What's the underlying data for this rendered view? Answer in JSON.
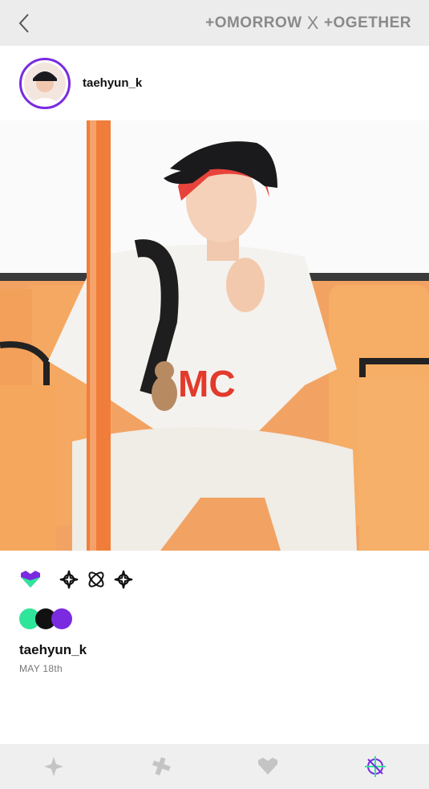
{
  "header": {
    "brand_left": "+OMORROW",
    "brand_sep": "X",
    "brand_right": "+OGETHER"
  },
  "post": {
    "username": "taehyun_k",
    "caption_username": "taehyun_k",
    "date": "MAY 18th"
  },
  "colors": {
    "accent_purple": "#7a2be0",
    "mint": "#2ee59a",
    "black": "#111111",
    "nav_icon": "#bdbdbd"
  },
  "icons": {
    "back": "chevron-left-icon",
    "heart": "heart-icon",
    "reactions": [
      "star-burst-icon",
      "atom-icon",
      "star-burst-icon"
    ],
    "nav": [
      "sparkle-icon",
      "bandage-icon",
      "heart-icon",
      "txt-logo-icon"
    ]
  }
}
